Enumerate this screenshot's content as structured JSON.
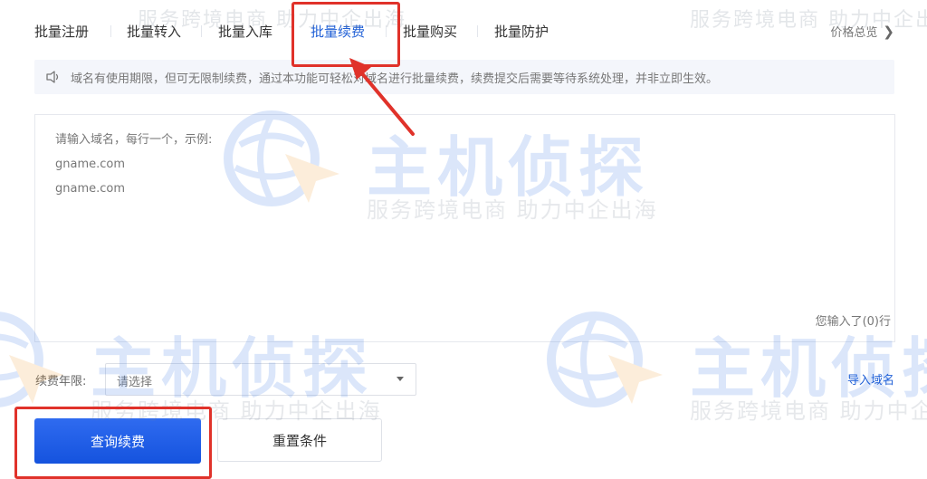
{
  "tabs": [
    {
      "label": "批量注册",
      "active": false
    },
    {
      "label": "批量转入",
      "active": false
    },
    {
      "label": "批量入库",
      "active": false
    },
    {
      "label": "批量续费",
      "active": true
    },
    {
      "label": "批量购买",
      "active": false
    },
    {
      "label": "批量防护",
      "active": false
    }
  ],
  "price_link": {
    "label": "价格总览",
    "icon": "chevron-right-icon"
  },
  "notice": {
    "icon": "speaker-icon",
    "text": "域名有使用期限，但可无限制续费，通过本功能可轻松对域名进行批量续费，续费提交后需要等待系统处理，并非立即生效。"
  },
  "domain_input": {
    "placeholder_lines": [
      "请输入域名，每行一个，示例:",
      "gname.com",
      "gname.com"
    ],
    "count_text": "您输入了(0)行"
  },
  "renewal_years": {
    "label": "续费年限:",
    "placeholder": "请选择"
  },
  "import_link": "导入域名",
  "buttons": {
    "query": "查询续费",
    "reset": "重置条件"
  },
  "watermark": {
    "title": "主机侦探",
    "subtitle": "服务跨境电商  助力中企出海"
  },
  "colors": {
    "accent": "#1f5fd6",
    "primary_button": "#1553de",
    "highlight": "#e0322a",
    "notice_bg": "#f4f6fb"
  }
}
